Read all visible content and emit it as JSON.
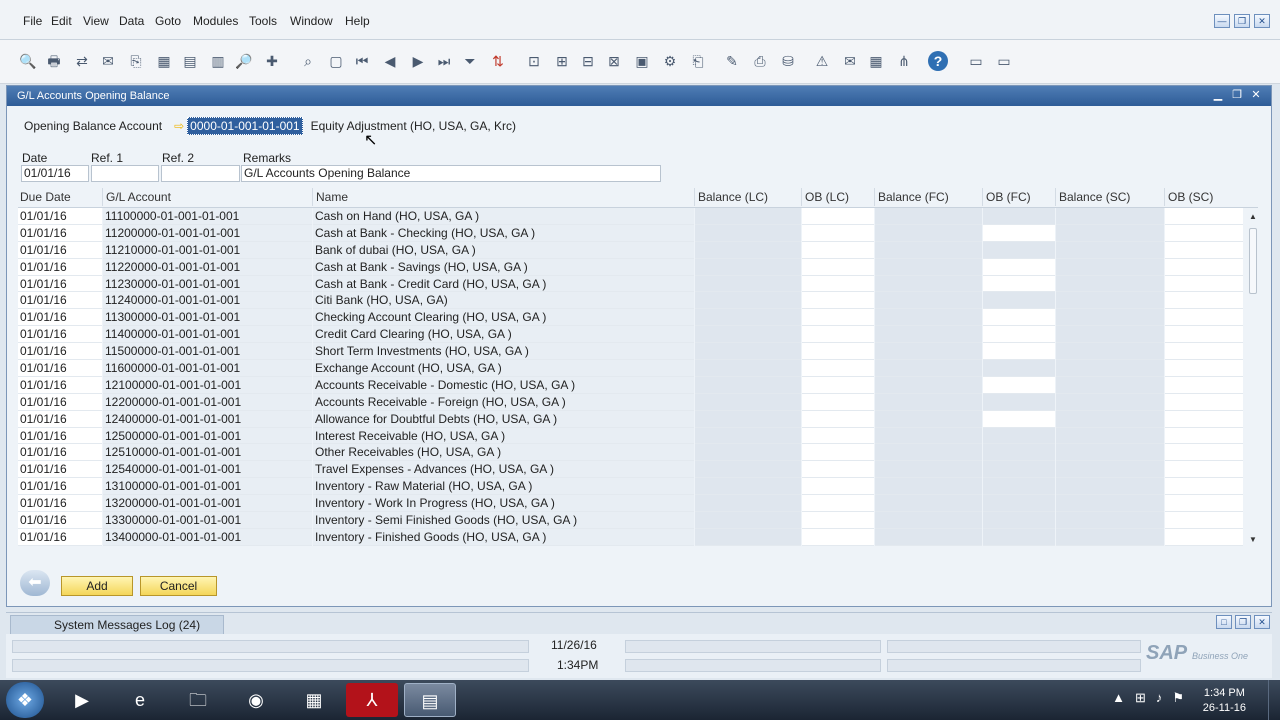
{
  "menu": [
    "File",
    "Edit",
    "View",
    "Data",
    "Goto",
    "Modules",
    "Tools",
    "Window",
    "Help"
  ],
  "toolbar_icons": [
    "preview-icon",
    "print-icon",
    "export-icon",
    "mail-icon",
    "copy-icon",
    "excel-icon",
    "word-icon",
    "pdf-icon",
    "find-icon",
    "add-icon",
    "binoculars-icon",
    "blank-icon",
    "first-record-icon",
    "prev-record-icon",
    "next-record-icon",
    "last-record-icon",
    "filter-icon",
    "sort-icon",
    "base-doc-icon",
    "target-doc-icon",
    "trans-journal-icon",
    "payment-icon",
    "gross-profit-icon",
    "settings-icon",
    "open-icon",
    "edit-icon",
    "layout-icon",
    "db-icon",
    "alert-icon",
    "message-icon",
    "calendar-icon",
    "org-icon",
    "help-icon",
    "doc1-icon",
    "doc2-icon"
  ],
  "window": {
    "title": "G/L Accounts Opening Balance"
  },
  "form": {
    "opening_balance_label": "Opening Balance Account",
    "account_code": "0000-01-001-01-001",
    "account_name": "Equity Adjustment (HO, USA, GA, Krc)",
    "date_label": "Date",
    "ref1_label": "Ref. 1",
    "ref2_label": "Ref. 2",
    "remarks_label": "Remarks",
    "date_value": "01/01/16",
    "ref1_value": "",
    "ref2_value": "",
    "remarks_value": "G/L Accounts Opening Balance"
  },
  "grid": {
    "columns": [
      "Due Date",
      "G/L Account",
      "Name",
      "Balance (LC)",
      "OB (LC)",
      "Balance (FC)",
      "OB (FC)",
      "Balance (SC)",
      "OB (SC)"
    ],
    "rows": [
      {
        "date": "01/01/16",
        "account": "11100000-01-001-01-001",
        "name": "Cash on Hand (HO, USA, GA )",
        "ob_fc_editable": false
      },
      {
        "date": "01/01/16",
        "account": "11200000-01-001-01-001",
        "name": "Cash at Bank - Checking (HO, USA, GA )",
        "ob_fc_editable": true
      },
      {
        "date": "01/01/16",
        "account": "11210000-01-001-01-001",
        "name": "Bank of dubai (HO, USA, GA )",
        "ob_fc_editable": false
      },
      {
        "date": "01/01/16",
        "account": "11220000-01-001-01-001",
        "name": "Cash at Bank - Savings (HO, USA, GA )",
        "ob_fc_editable": true
      },
      {
        "date": "01/01/16",
        "account": "11230000-01-001-01-001",
        "name": "Cash at Bank - Credit Card (HO, USA, GA )",
        "ob_fc_editable": true
      },
      {
        "date": "01/01/16",
        "account": "11240000-01-001-01-001",
        "name": "Citi Bank (HO, USA, GA)",
        "ob_fc_editable": false
      },
      {
        "date": "01/01/16",
        "account": "11300000-01-001-01-001",
        "name": "Checking Account Clearing (HO, USA, GA )",
        "ob_fc_editable": true
      },
      {
        "date": "01/01/16",
        "account": "11400000-01-001-01-001",
        "name": "Credit Card Clearing (HO, USA, GA )",
        "ob_fc_editable": true
      },
      {
        "date": "01/01/16",
        "account": "11500000-01-001-01-001",
        "name": "Short Term Investments (HO, USA, GA )",
        "ob_fc_editable": true
      },
      {
        "date": "01/01/16",
        "account": "11600000-01-001-01-001",
        "name": "Exchange Account (HO, USA, GA )",
        "ob_fc_editable": false
      },
      {
        "date": "01/01/16",
        "account": "12100000-01-001-01-001",
        "name": "Accounts Receivable - Domestic (HO, USA, GA )",
        "ob_fc_editable": true
      },
      {
        "date": "01/01/16",
        "account": "12200000-01-001-01-001",
        "name": "Accounts Receivable - Foreign (HO, USA, GA )",
        "ob_fc_editable": false
      },
      {
        "date": "01/01/16",
        "account": "12400000-01-001-01-001",
        "name": "Allowance for Doubtful Debts (HO, USA, GA )",
        "ob_fc_editable": true
      },
      {
        "date": "01/01/16",
        "account": "12500000-01-001-01-001",
        "name": "Interest Receivable (HO, USA, GA )",
        "ob_fc_editable": false
      },
      {
        "date": "01/01/16",
        "account": "12510000-01-001-01-001",
        "name": "Other Receivables (HO, USA, GA )",
        "ob_fc_editable": false
      },
      {
        "date": "01/01/16",
        "account": "12540000-01-001-01-001",
        "name": "Travel Expenses - Advances (HO, USA, GA )",
        "ob_fc_editable": false
      },
      {
        "date": "01/01/16",
        "account": "13100000-01-001-01-001",
        "name": "Inventory - Raw Material (HO, USA, GA )",
        "ob_fc_editable": false
      },
      {
        "date": "01/01/16",
        "account": "13200000-01-001-01-001",
        "name": "Inventory - Work In Progress (HO, USA, GA )",
        "ob_fc_editable": false
      },
      {
        "date": "01/01/16",
        "account": "13300000-01-001-01-001",
        "name": "Inventory - Semi Finished Goods (HO, USA, GA )",
        "ob_fc_editable": false
      },
      {
        "date": "01/01/16",
        "account": "13400000-01-001-01-001",
        "name": "Inventory - Finished Goods (HO, USA, GA )",
        "ob_fc_editable": false
      }
    ]
  },
  "buttons": {
    "add": "Add",
    "cancel": "Cancel"
  },
  "message_log": {
    "label": "System Messages Log (24)"
  },
  "status": {
    "date": "11/26/16",
    "time": "1:34PM",
    "logo": "SAP",
    "logo_sub": "Business One"
  },
  "taskbar": {
    "clock_time": "1:34 PM",
    "clock_date": "26-11-16"
  }
}
